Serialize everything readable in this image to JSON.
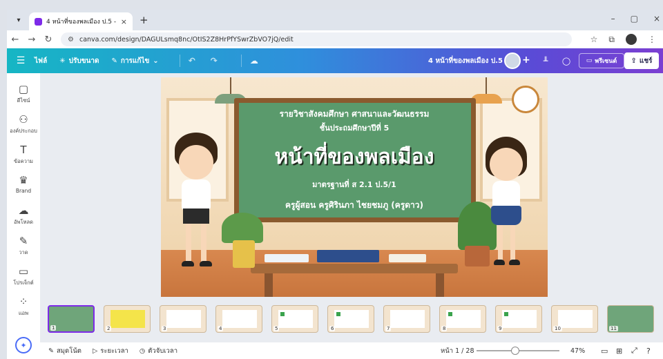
{
  "browser": {
    "tab_title": "4 หน้าที่ของพลเมือง ป.5 - พรีเซนเ...",
    "tab_close": "×",
    "new_tab": "+",
    "url": "canva.com/design/DAGULsmq8nc/OtIS2Z8HrPfYSwrZbVO7jQ/edit",
    "window_controls": [
      "–",
      "▢",
      "×"
    ]
  },
  "canva_header": {
    "file": "ไฟล์",
    "resize": "ปรับขนาด",
    "editing": "การแก้ไข",
    "doc_title": "4 หน้าที่ของพลเมือง ป.5",
    "present": "พรีเซนต์",
    "share": "แชร์"
  },
  "sidebar": {
    "items": [
      {
        "label": "ดีไซน์",
        "icon": "design-icon"
      },
      {
        "label": "องค์ประกอบ",
        "icon": "elements-icon"
      },
      {
        "label": "ข้อความ",
        "icon": "text-icon"
      },
      {
        "label": "Brand",
        "icon": "brand-icon"
      },
      {
        "label": "อัพโหลด",
        "icon": "upload-icon"
      },
      {
        "label": "วาด",
        "icon": "draw-icon"
      },
      {
        "label": "โปรเจ็กต์",
        "icon": "projects-icon"
      },
      {
        "label": "แอพ",
        "icon": "apps-icon"
      }
    ]
  },
  "slide": {
    "line1": "รายวิชาสังคมศึกษา ศาสนาและวัฒนธรรม",
    "line2": "ชั้นประถมศึกษาปีที่ 5",
    "title": "หน้าที่ของพลเมือง",
    "standard": "มาตรฐานที่ ส 2.1 ป.5/1",
    "teacher": "ครูผู้สอน ครูศิรินภา ไชยชมภู (ครูดาว)"
  },
  "thumbnails": [
    "1",
    "2",
    "3",
    "4",
    "5",
    "6",
    "7",
    "8",
    "9",
    "10",
    "11"
  ],
  "bottom_bar": {
    "notes": "สมุดโน้ต",
    "duration": "ระยะเวลา",
    "timer": "ตัวจับเวลา",
    "page": "หน้า 1 / 28",
    "zoom": "47%",
    "zoom_level": 0.47
  }
}
